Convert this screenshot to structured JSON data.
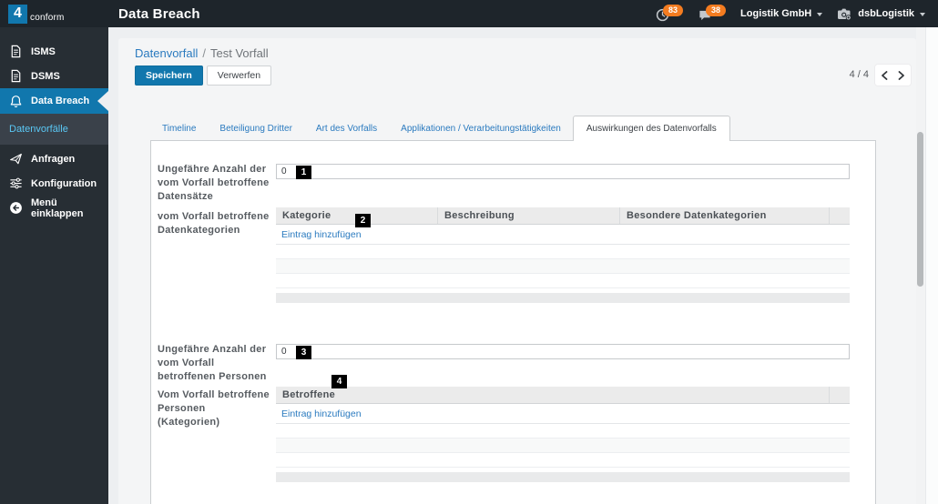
{
  "header": {
    "logo_number": "4",
    "logo_brand": "conform",
    "title": "Data Breach",
    "notifications": [
      {
        "icon": "clock-icon",
        "count": "83"
      },
      {
        "icon": "chat-icon",
        "count": "38"
      }
    ],
    "org_label": "Logistik GmbH",
    "user_label": "dsbLogistik"
  },
  "sidebar": {
    "items": [
      {
        "label": "ISMS",
        "icon": "document-icon"
      },
      {
        "label": "DSMS",
        "icon": "document-icon"
      },
      {
        "label": "Data Breach",
        "icon": "bell-icon",
        "active": true
      },
      {
        "label": "Datenvorfälle",
        "submenu": true
      },
      {
        "label": "Anfragen",
        "icon": "paper-plane-icon"
      },
      {
        "label": "Konfiguration",
        "icon": "sliders-icon"
      },
      {
        "label": "Menü einklappen",
        "icon": "collapse-icon"
      }
    ]
  },
  "toolbar": {
    "breadcrumb_parent": "Datenvorfall",
    "breadcrumb_sep": "/",
    "breadcrumb_current": "Test Vorfall",
    "save_label": "Speichern",
    "discard_label": "Verwerfen",
    "page_indicator": "4 / 4"
  },
  "tabs": {
    "items": [
      "Timeline",
      "Beteiligung Dritter",
      "Art des Vorfalls",
      "Applikationen / Verarbeitungstätigkeiten",
      "Auswirkungen des Datenvorfalls"
    ],
    "active_index": 4
  },
  "form": {
    "groups": [
      {
        "label": "Ungefähre Anzahl der vom Vorfall betroffene Datensätze",
        "value": "0",
        "marker": "1"
      },
      {
        "label": "vom Vorfall betroffene Datenkategorien",
        "marker": "2",
        "table": {
          "headers": [
            "Kategorie",
            "Beschreibung",
            "Besondere Datenkategorien"
          ],
          "add_link": "Eintrag hinzufügen"
        }
      },
      {
        "label": "Ungefähre Anzahl der vom Vorfall betroffenen Personen",
        "value": "0",
        "marker": "3"
      },
      {
        "label": "Vom Vorfall betroffene Personen (Kategorien)",
        "marker": "4",
        "table": {
          "headers": [
            "Betroffene"
          ],
          "add_link": "Eintrag hinzufügen"
        }
      }
    ]
  },
  "colors": {
    "accent_blue": "#1177ad",
    "link_blue": "#2a7abf",
    "badge_orange": "#f47c20",
    "sidebar_dark": "#272e34",
    "topbar_dark": "#1e252b",
    "marker_black": "#000000"
  }
}
